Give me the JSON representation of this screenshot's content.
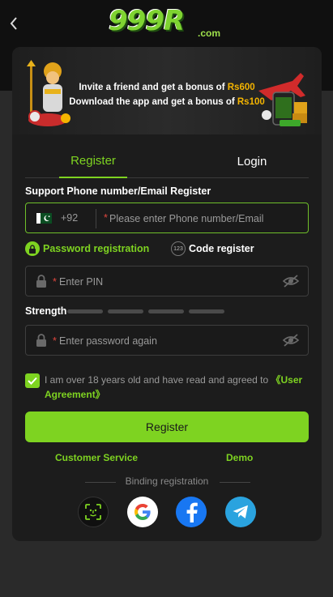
{
  "header": {
    "logo_text": "999R",
    "logo_suffix": ".com"
  },
  "banner": {
    "line1_prefix": "Invite a friend and get a bonus of ",
    "line1_amount": "Rs600",
    "line2_prefix": "Download the app and get a bonus of ",
    "line2_amount": "Rs100"
  },
  "tabs": [
    {
      "label": "Register",
      "active": true
    },
    {
      "label": "Login",
      "active": false
    }
  ],
  "form": {
    "section_label": "Support Phone number/Email Register",
    "dial_code": "+92",
    "required_mark": "*",
    "phone_placeholder": "Please enter Phone number/Email",
    "mode_password": "Password registration",
    "mode_code": "Code register",
    "mode_code_icon_text": "123",
    "pin_placeholder": "Enter PIN",
    "strength_label": "Strength",
    "confirm_placeholder": "Enter password again",
    "agree_text": "I am over 18 years old and have read and agreed to ",
    "agree_link": "《User Agreement》",
    "agree_checked": true,
    "register_button": "Register"
  },
  "links": {
    "customer_service": "Customer Service",
    "demo": "Demo"
  },
  "binding": {
    "label": "Binding registration",
    "options": [
      "face-scan-icon",
      "google-icon",
      "facebook-icon",
      "telegram-icon"
    ]
  },
  "colors": {
    "accent": "#7ed321",
    "background": "#2a2a2a",
    "card": "#1c1c1c",
    "required": "#e0463e",
    "bonus": "#f4b400"
  }
}
